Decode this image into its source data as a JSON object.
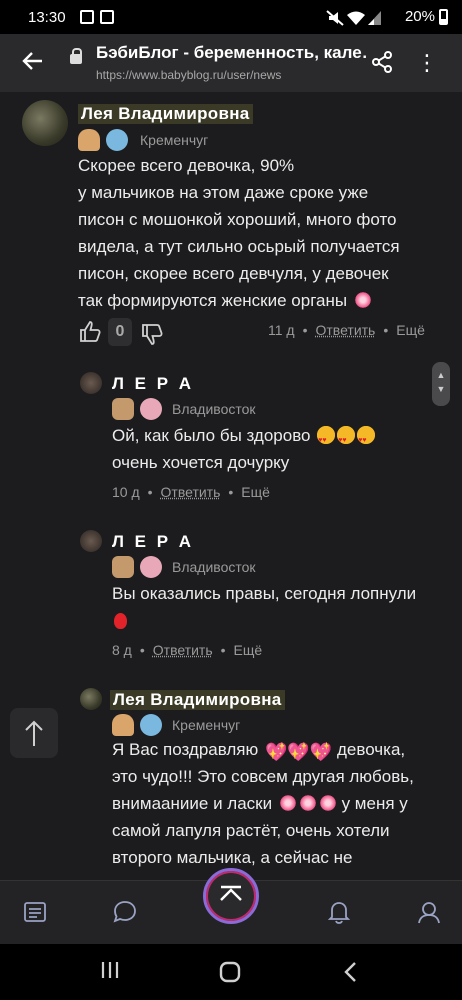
{
  "status_bar": {
    "time": "13:30",
    "battery": "20%"
  },
  "browser": {
    "title": "БэбиБлог - беременность, кале…",
    "url": "https://www.babyblog.ru/user/news"
  },
  "comments": [
    {
      "author": "Лея Владимировна",
      "city": "Кременчуг",
      "lines": [
        "Скорее всего девочка, 90%",
        "у мальчиков на этом даже сроке уже",
        "писон с мошонкой хороший, много фото",
        "видела, а тут сильно осьрый получается",
        "писон, скорее всего девчуля, у девочек",
        "так формируются женские органы"
      ],
      "votes": "0",
      "age": "11 д",
      "reply": "Ответить",
      "more": "Ещё"
    },
    {
      "author": "Л Е Р А",
      "city": "Владивосток",
      "lines": [
        "Ой, как было бы здорово",
        "очень хочется дочурку"
      ],
      "age": "10 д",
      "reply": "Ответить",
      "more": "Ещё"
    },
    {
      "author": "Л Е Р А",
      "city": "Владивосток",
      "lines": [
        "Вы оказались правы, сегодня лопнули"
      ],
      "age": "8 д",
      "reply": "Ответить",
      "more": "Ещё"
    },
    {
      "author": "Лея Владимировна",
      "city": "Кременчуг",
      "lines": [
        "Я Вас поздравляю",
        "девочка,",
        "это чудо!!! Это совсем другая любовь,",
        "внимааниие и ласки",
        "у меня у",
        "самой лапуля растёт, очень хотели",
        "второго мальчика, а сейчас не"
      ]
    }
  ],
  "colors": {
    "accent_purple": "#8a6bd8",
    "accent_pink": "#c22a6e",
    "background": "#1c1c1e"
  }
}
